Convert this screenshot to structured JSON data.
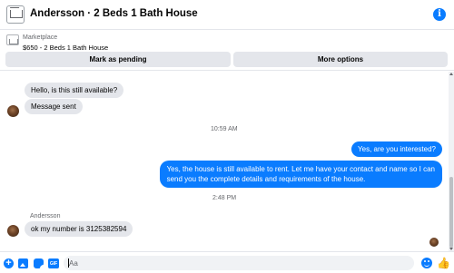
{
  "header": {
    "title": "Andersson · 2 Beds 1 Bath House",
    "info_icon_glyph": "i"
  },
  "marketplace": {
    "source": "Marketplace",
    "listing": "$650 - 2 Beds 1 Bath House"
  },
  "actions": {
    "mark_pending": "Mark as pending",
    "more_options": "More options"
  },
  "thread": {
    "messages": [
      {
        "direction": "incoming",
        "text": "Hello, is this still available?"
      },
      {
        "direction": "incoming",
        "text": "Message sent"
      },
      {
        "type": "timestamp",
        "text": "10:59 AM"
      },
      {
        "direction": "outgoing",
        "text": "Yes, are you interested?"
      },
      {
        "direction": "outgoing",
        "lines": [
          "Yes, the house is still available to rent. Let me have your contact and name so I can",
          "send you the complete details and requirements of the house."
        ]
      },
      {
        "type": "timestamp",
        "text": "2:48 PM"
      },
      {
        "type": "sender",
        "text": "Andersson"
      },
      {
        "direction": "incoming",
        "text": "ok my number is 3125382594"
      }
    ]
  },
  "composer": {
    "placeholder": "Aa",
    "gif_label": "GIF",
    "plus_glyph": "+",
    "like_glyph": "👍"
  },
  "colors": {
    "accent": "#0a7cff",
    "incoming_bubble": "#e4e6eb",
    "secondary_text": "#65676b"
  }
}
